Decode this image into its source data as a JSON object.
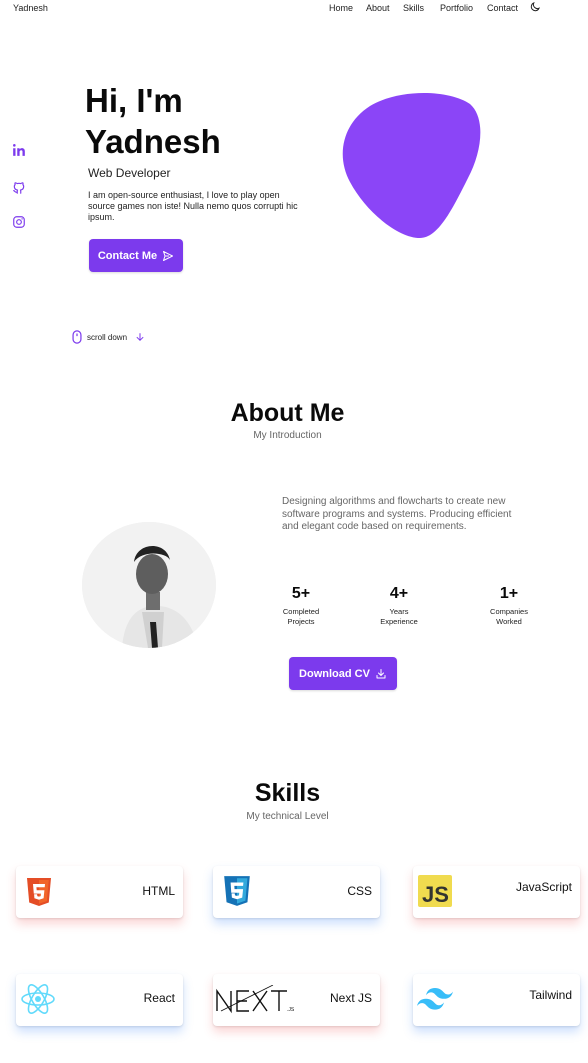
{
  "header": {
    "brand": "Yadnesh",
    "nav": [
      "Home",
      "About",
      "Skills",
      "Portfolio",
      "Contact"
    ]
  },
  "hero": {
    "title_line1": "Hi, I'm",
    "title_line2": "Yadnesh",
    "subtitle": "Web Developer",
    "description": "I am open-source enthusiast, I love to play open source games non iste! Nulla nemo quos corrupti hic ipsum.",
    "contact_button": "Contact Me",
    "scroll_label": "scroll down"
  },
  "about": {
    "title": "About Me",
    "subtitle": "My Introduction",
    "description": "Designing algorithms and flowcharts to create new software programs and systems. Producing efficient and elegant code based on requirements.",
    "stats": [
      {
        "value": "5+",
        "label_line1": "Completed",
        "label_line2": "Projects"
      },
      {
        "value": "4+",
        "label_line1": "Years",
        "label_line2": "Experience"
      },
      {
        "value": "1+",
        "label_line1": "Companies",
        "label_line2": "Worked"
      }
    ],
    "cv_button": "Download CV"
  },
  "skills": {
    "title": "Skills",
    "subtitle": "My technical Level",
    "items": [
      {
        "label": "HTML",
        "icon": "html5-icon"
      },
      {
        "label": "CSS",
        "icon": "css3-icon"
      },
      {
        "label": "JavaScript",
        "icon": "javascript-icon"
      },
      {
        "label": "React",
        "icon": "react-icon"
      },
      {
        "label": "Next JS",
        "icon": "nextjs-icon"
      },
      {
        "label": "Tailwind",
        "icon": "tailwind-icon"
      }
    ]
  },
  "colors": {
    "accent": "#7c3aed",
    "blob": "#8b45f7"
  }
}
